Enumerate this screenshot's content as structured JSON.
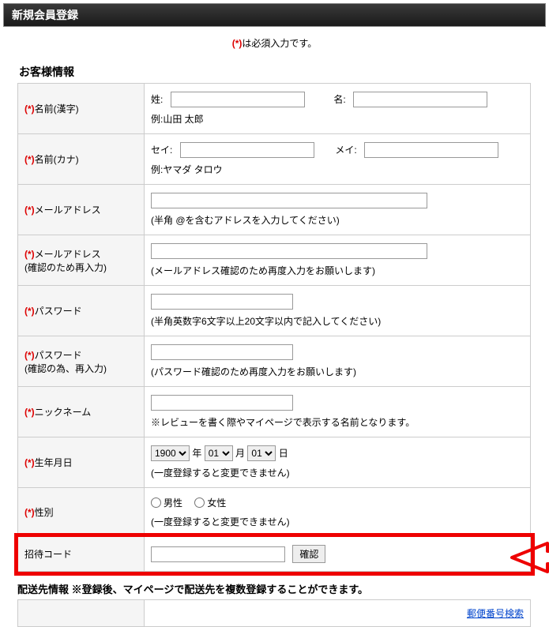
{
  "header": {
    "title": "新規会員登録"
  },
  "required_note": {
    "prefix": "(*)",
    "text": "は必須入力です。"
  },
  "section_customer": "お客様情報",
  "section_shipping": "配送先情報 ※登録後、マイページで配送先を複数登録することができます。",
  "rows": {
    "name_kanji": {
      "label": "名前(漢字)",
      "sei": "姓:",
      "mei": "名:",
      "example": "例:山田 太郎"
    },
    "name_kana": {
      "label": "名前(カナ)",
      "sei": "セイ:",
      "mei": "メイ:",
      "example": "例:ヤマダ タロウ"
    },
    "email": {
      "label": "メールアドレス",
      "hint": "(半角 @を含むアドレスを入力してください)"
    },
    "email_confirm": {
      "label1": "メールアドレス",
      "label2": "(確認のため再入力)",
      "hint": "(メールアドレス確認のため再度入力をお願いします)"
    },
    "password": {
      "label": "パスワード",
      "hint": "(半角英数字6文字以上20文字以内で記入してください)"
    },
    "password_confirm": {
      "label1": "パスワード",
      "label2": "(確認の為、再入力)",
      "hint": "(パスワード確認のため再度入力をお願いします)"
    },
    "nickname": {
      "label": "ニックネーム",
      "hint": "※レビューを書く際やマイページで表示する名前となります。"
    },
    "birthday": {
      "label": "生年月日",
      "year_suffix": "年",
      "month_suffix": "月",
      "day_suffix": "日",
      "year": "1900",
      "month": "01",
      "day": "01",
      "hint": "(一度登録すると変更できません)"
    },
    "gender": {
      "label": "性別",
      "male": "男性",
      "female": "女性",
      "hint": "(一度登録すると変更できません)"
    },
    "invite": {
      "label": "招待コード",
      "btn": "確認"
    }
  },
  "postal_search": "郵便番号検索"
}
